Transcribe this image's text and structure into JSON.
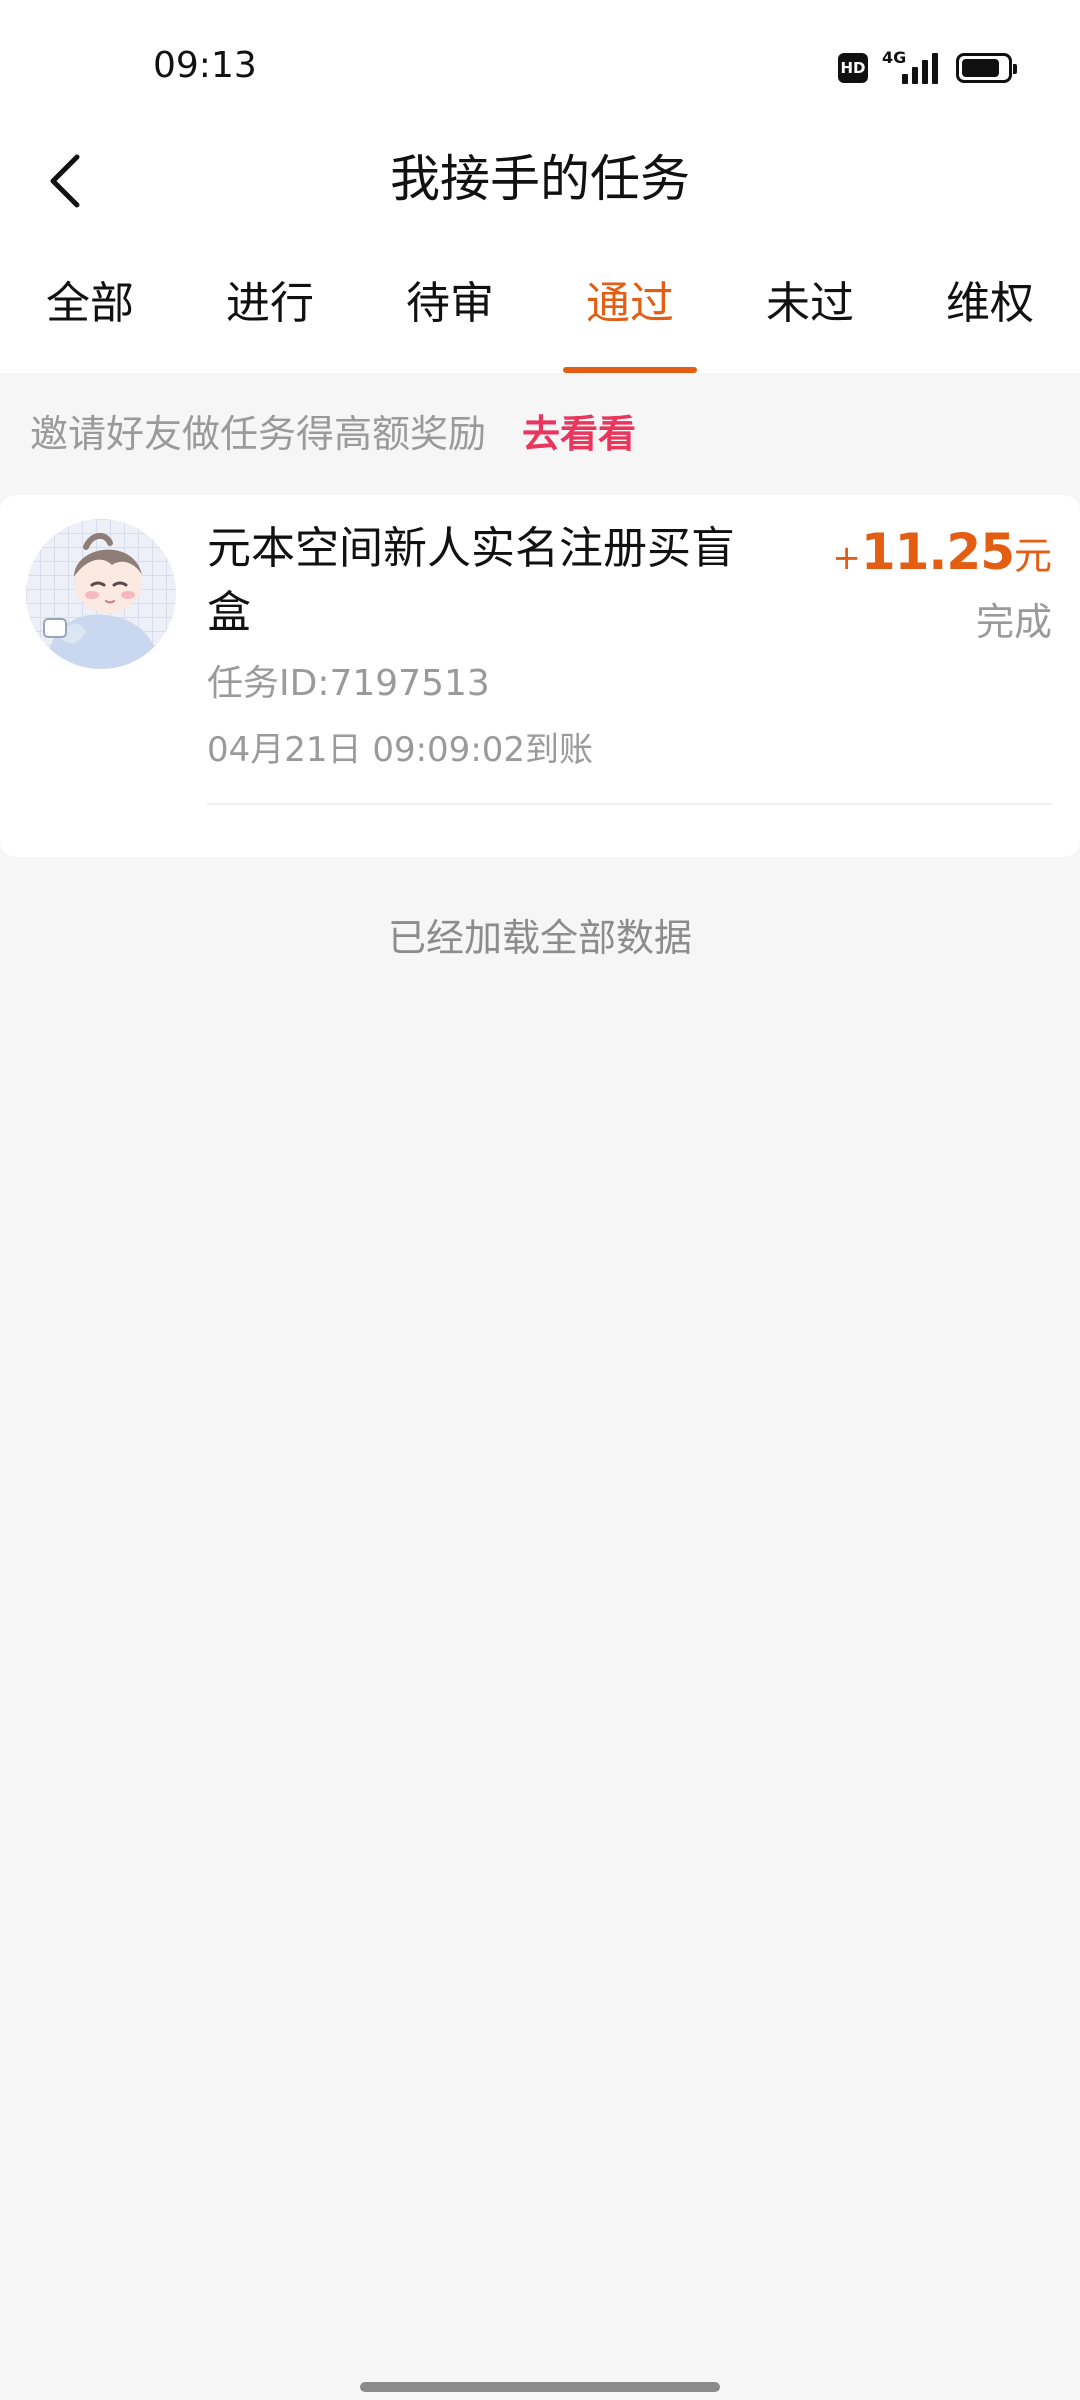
{
  "status_bar": {
    "time": "09:13",
    "hd_label": "HD",
    "network_label": "4G",
    "battery_level": 0.85
  },
  "header": {
    "back_icon": "chevron-left-icon",
    "title": "我接手的任务"
  },
  "tabs": [
    {
      "label": "全部",
      "active": false
    },
    {
      "label": "进行",
      "active": false
    },
    {
      "label": "待审",
      "active": false
    },
    {
      "label": "通过",
      "active": true
    },
    {
      "label": "未过",
      "active": false
    },
    {
      "label": "维权",
      "active": false
    }
  ],
  "invite_banner": {
    "text": "邀请好友做任务得高额奖励",
    "link": "去看看"
  },
  "tasks": [
    {
      "title": "元本空间新人实名注册买盲盒",
      "task_id": "任务ID:7197513",
      "time": "04月21日 09:09:02到账",
      "amount_sign": "+",
      "amount": "11.25",
      "unit": "元",
      "status": "完成"
    }
  ],
  "footer_text": "已经加载全部数据",
  "colors": {
    "accent": "#e35d13",
    "link": "#e8365d",
    "muted": "#9a9a9a",
    "background": "#f6f6f6"
  }
}
